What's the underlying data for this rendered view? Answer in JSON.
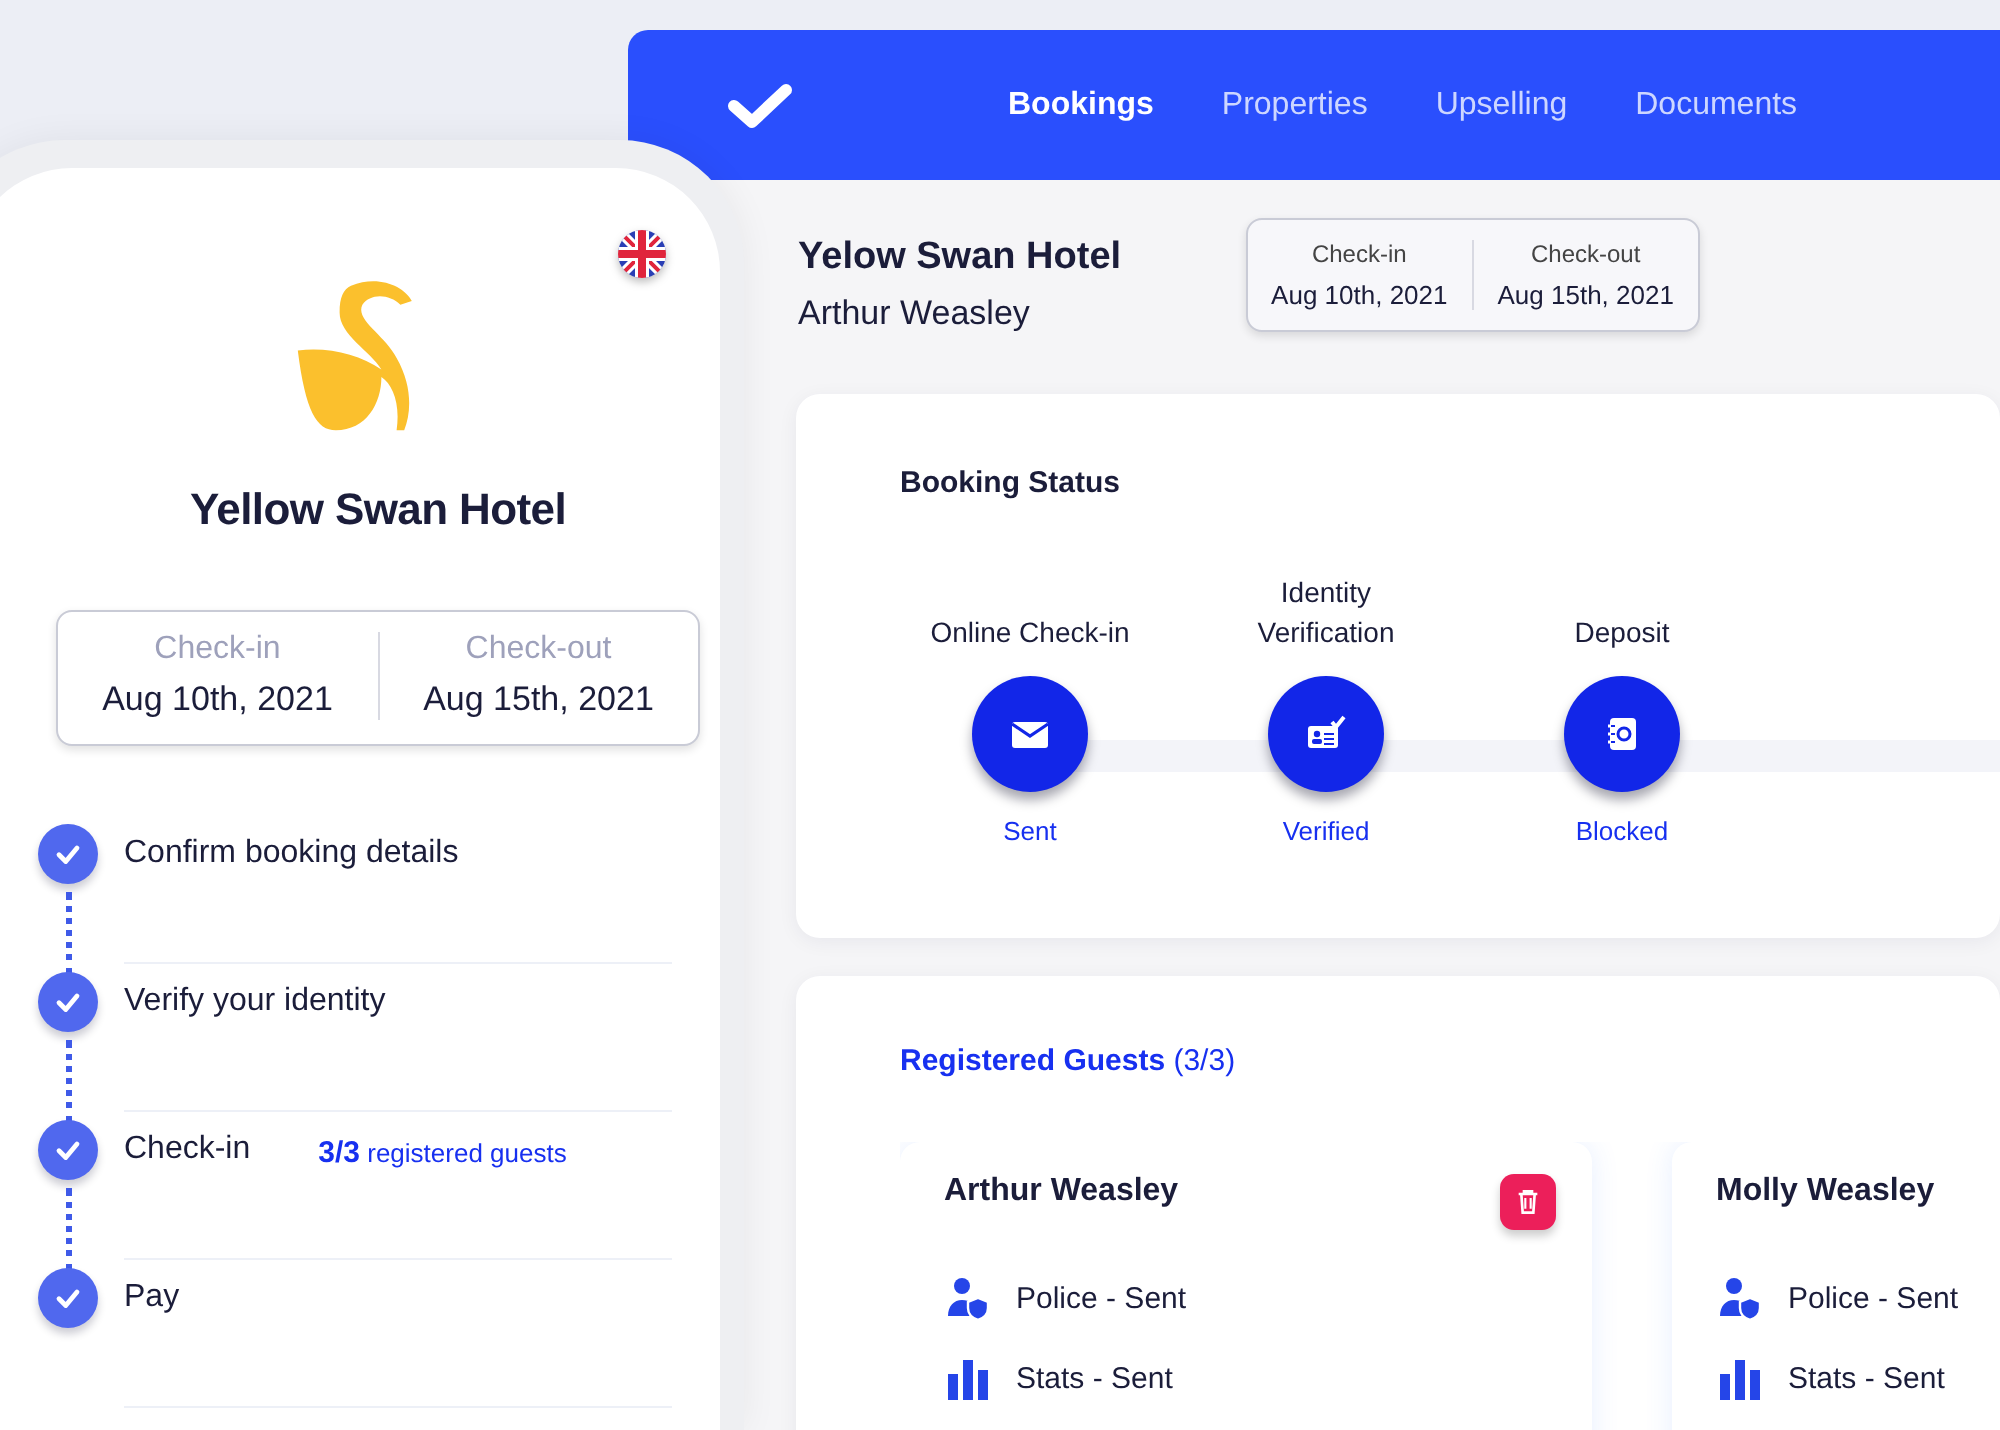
{
  "dashboard": {
    "nav": [
      {
        "label": "Bookings",
        "selected": true
      },
      {
        "label": "Properties",
        "selected": false
      },
      {
        "label": "Upselling",
        "selected": false
      },
      {
        "label": "Documents",
        "selected": false
      }
    ],
    "hotel": "Yelow Swan Hotel",
    "guest": "Arthur Weasley",
    "dates": [
      {
        "label": "Check-in",
        "value": "Aug 10th, 2021"
      },
      {
        "label": "Check-out",
        "value": "Aug 15th, 2021"
      }
    ],
    "booking_status": {
      "title": "Booking Status",
      "steps": [
        {
          "label": "Online Check-in",
          "kind": "mail",
          "status": "Sent"
        },
        {
          "label": "Identity Verification",
          "kind": "id",
          "status": "Verified"
        },
        {
          "label": "Deposit",
          "kind": "safe",
          "status": "Blocked"
        }
      ]
    },
    "registered_guests": {
      "title": "Registered Guests",
      "count": "(3/3)",
      "guests": [
        {
          "name": "Arthur Weasley",
          "deletable": true,
          "items": [
            {
              "kind": "police",
              "text": "Police - Sent"
            },
            {
              "kind": "stats",
              "text": "Stats - Sent"
            }
          ]
        },
        {
          "name": "Molly Weasley",
          "items": [
            {
              "kind": "police",
              "text": "Police - Sent"
            },
            {
              "kind": "stats",
              "text": "Stats - Sent"
            }
          ]
        }
      ]
    }
  },
  "phone": {
    "hotel": "Yellow Swan Hotel",
    "dates": [
      {
        "label": "Check-in",
        "value": "Aug 10th, 2021"
      },
      {
        "label": "Check-out",
        "value": "Aug 15th, 2021"
      }
    ],
    "steps": [
      {
        "label": "Confirm booking details",
        "checked": true
      },
      {
        "label": "Verify your identity",
        "checked": true
      },
      {
        "label": "Check-in",
        "checked": true,
        "count": "3/3",
        "note": "registered guests"
      },
      {
        "label": "Pay",
        "checked": true
      }
    ]
  }
}
